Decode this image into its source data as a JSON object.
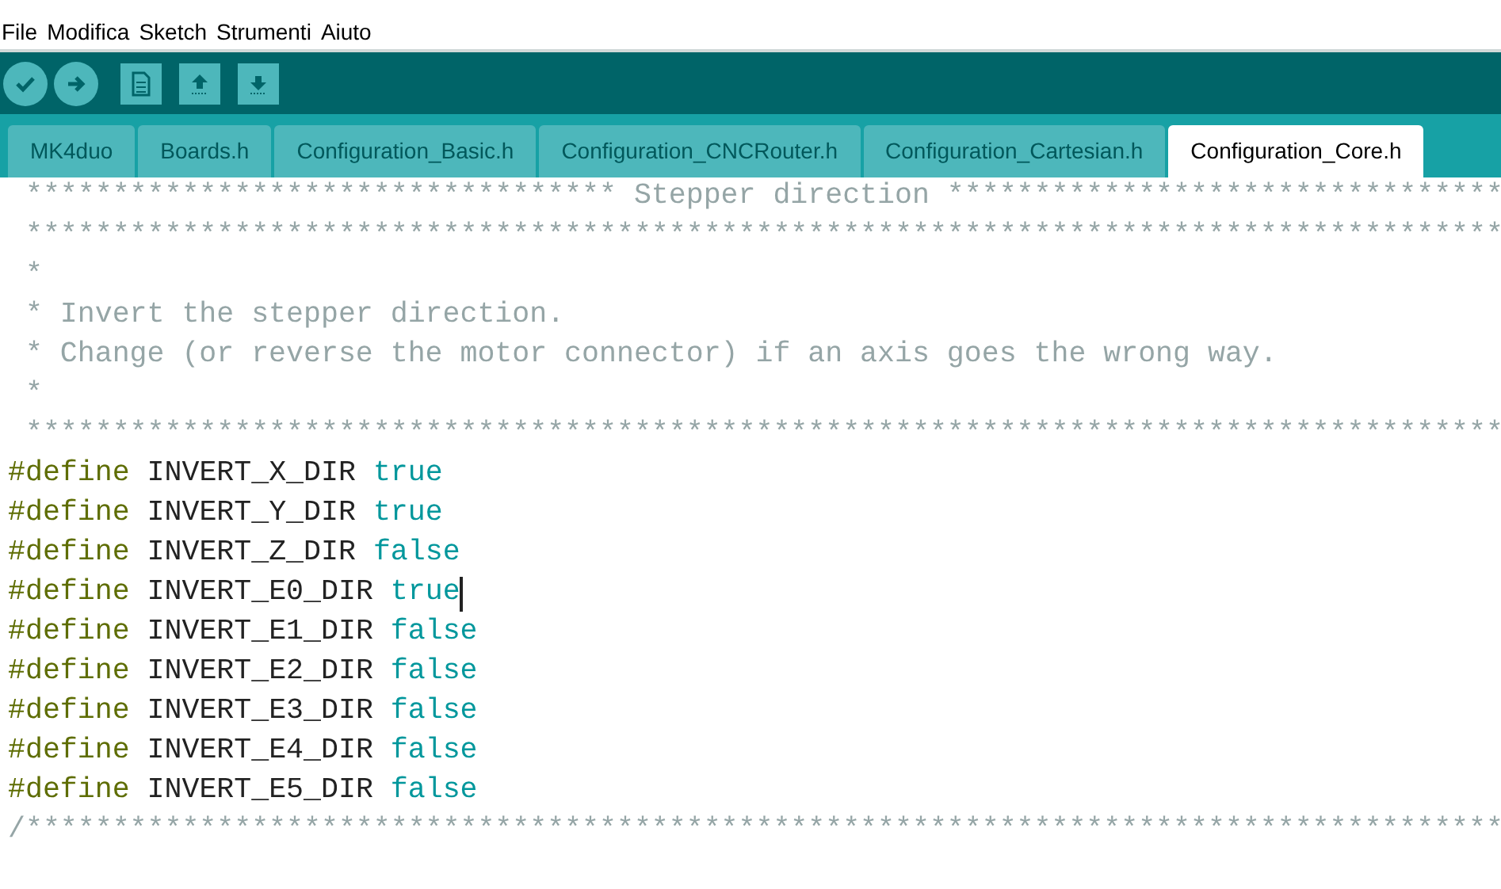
{
  "menu": [
    "File",
    "Modifica",
    "Sketch",
    "Strumenti",
    "Aiuto"
  ],
  "tabs": [
    {
      "label": "MK4duo",
      "selected": false
    },
    {
      "label": "Boards.h",
      "selected": false
    },
    {
      "label": "Configuration_Basic.h",
      "selected": false
    },
    {
      "label": "Configuration_CNCRouter.h",
      "selected": false
    },
    {
      "label": "Configuration_Cartesian.h",
      "selected": false
    },
    {
      "label": "Configuration_Core.h",
      "selected": true
    }
  ],
  "lines": [
    {
      "kind": "comment",
      "text": " ********************************** Stepper direction ********************************"
    },
    {
      "kind": "comment",
      "text": " *************************************************************************************"
    },
    {
      "kind": "comment",
      "text": " *"
    },
    {
      "kind": "comment",
      "text": " * Invert the stepper direction."
    },
    {
      "kind": "comment",
      "text": " * Change (or reverse the motor connector) if an axis goes the wrong way."
    },
    {
      "kind": "comment",
      "text": " *"
    },
    {
      "kind": "comment",
      "text": " *************************************************************************************"
    },
    {
      "kind": "define",
      "keyword": "#define",
      "name": "INVERT_X_DIR",
      "value": "true",
      "caret": false
    },
    {
      "kind": "define",
      "keyword": "#define",
      "name": "INVERT_Y_DIR",
      "value": "true",
      "caret": false
    },
    {
      "kind": "define",
      "keyword": "#define",
      "name": "INVERT_Z_DIR",
      "value": "false",
      "caret": false
    },
    {
      "kind": "define",
      "keyword": "#define",
      "name": "INVERT_E0_DIR",
      "value": "true",
      "caret": true
    },
    {
      "kind": "define",
      "keyword": "#define",
      "name": "INVERT_E1_DIR",
      "value": "false",
      "caret": false
    },
    {
      "kind": "define",
      "keyword": "#define",
      "name": "INVERT_E2_DIR",
      "value": "false",
      "caret": false
    },
    {
      "kind": "define",
      "keyword": "#define",
      "name": "INVERT_E3_DIR",
      "value": "false",
      "caret": false
    },
    {
      "kind": "define",
      "keyword": "#define",
      "name": "INVERT_E4_DIR",
      "value": "false",
      "caret": false
    },
    {
      "kind": "define",
      "keyword": "#define",
      "name": "INVERT_E5_DIR",
      "value": "false",
      "caret": false
    },
    {
      "kind": "comment",
      "text": "/*************************************************************************************"
    }
  ]
}
